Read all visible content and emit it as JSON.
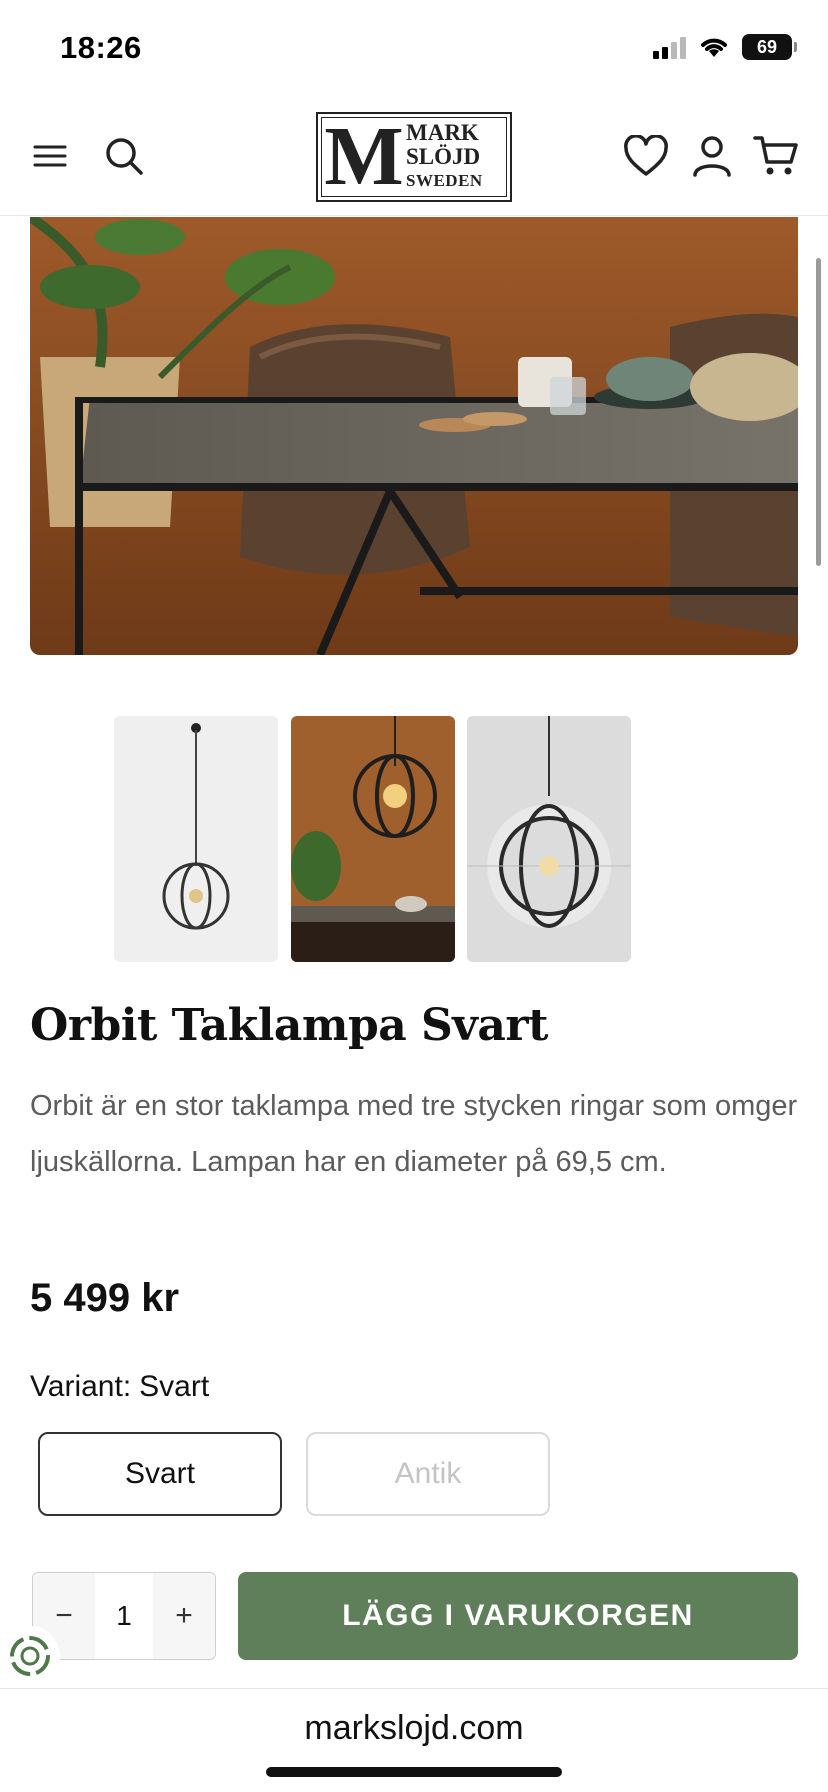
{
  "status_bar": {
    "time": "18:26",
    "battery": "69"
  },
  "header": {
    "logo": {
      "letter": "M",
      "line1": "MARK",
      "line2": "SLÖJD",
      "line3": "SWEDEN"
    }
  },
  "product": {
    "title": "Orbit Taklampa Svart",
    "description": "Orbit är en stor taklampa med tre stycken ringar som omger ljuskällorna. Lampan har en diameter på 69,5 cm.",
    "price": "5 499 kr",
    "variant_label": "Variant:",
    "variant_selected": "Svart",
    "variants": [
      "Svart",
      "Antik"
    ],
    "quantity": "1",
    "qty_minus": "−",
    "qty_plus": "+",
    "add_to_cart": "LÄGG I VARUKORGEN"
  },
  "browser": {
    "url": "markslojd.com"
  },
  "colors": {
    "accent_green": "#5f7f5b",
    "text_muted": "#5c5c5c"
  }
}
